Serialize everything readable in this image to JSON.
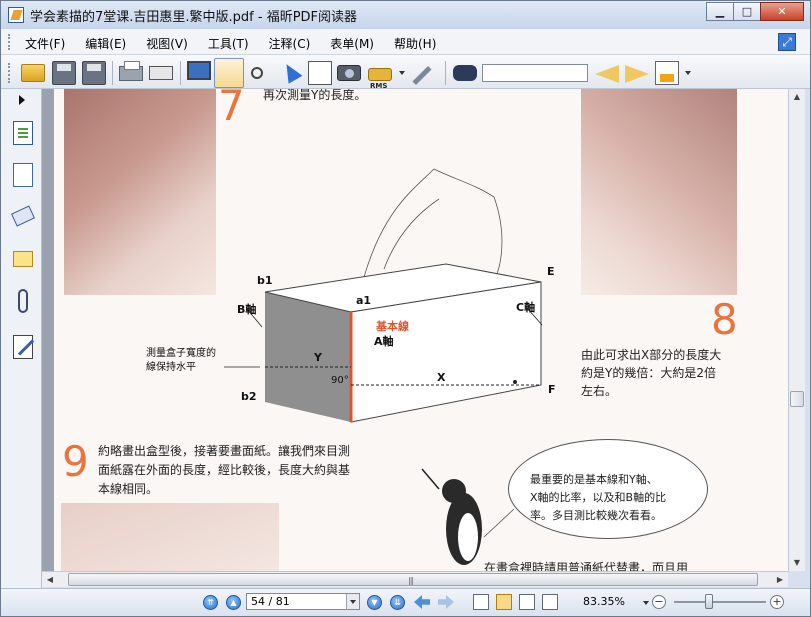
{
  "window": {
    "title": "学会素描的7堂课.吉田惠里.繁中版.pdf - 福昕PDF阅读器",
    "controls": {
      "minimize": "▁",
      "maximize": "□",
      "close": "✕"
    }
  },
  "menu": {
    "items": [
      {
        "label": "文件(F)"
      },
      {
        "label": "编辑(E)"
      },
      {
        "label": "视图(V)"
      },
      {
        "label": "工具(T)"
      },
      {
        "label": "注释(C)"
      },
      {
        "label": "表单(M)"
      },
      {
        "label": "帮助(H)"
      }
    ]
  },
  "toolbar": {
    "rms_label": "RMS",
    "search_value": ""
  },
  "page_content": {
    "step7_top_text": "再次測量Y的長度。",
    "step7_number": "7",
    "step8_number": "8",
    "step8_text": [
      "由此可求出X部分的長度大",
      "約是Y的幾倍：大約是2倍",
      "左右。"
    ],
    "step9_number": "9",
    "step9_text": [
      "約略畫出盒型後，接著要畫面紙。讓我們來目測",
      "面紙露在外面的長度，經比較後，長度大約與基",
      "本線相同。"
    ],
    "diagram_labels": {
      "b1": "b1",
      "a1": "a1",
      "E": "E",
      "B_axis": "B軸",
      "C_axis": "C軸",
      "base_line": "基本線",
      "A_axis": "A軸",
      "Y": "Y",
      "X": "X",
      "angle": "90°",
      "b2": "b2",
      "F": "F",
      "note_line1": "測量盒子寬度的",
      "note_line2": "線保持水平"
    },
    "bubble_text": [
      "最重要的是基本線和Y軸、",
      "X軸的比率，以及和B軸的比",
      "率。多目測比較幾次看看。"
    ],
    "bottom_cut_text": "在畫盒裡時請用普通紙代替畫，而且用"
  },
  "statusbar": {
    "page_display": "54 / 81",
    "current_page": 54,
    "total_pages": 81,
    "zoom": "83.35%"
  },
  "colors": {
    "accent_orange": "#e8743f",
    "base_line_red": "#e2532d",
    "window_frame": "#d6e0ee"
  }
}
